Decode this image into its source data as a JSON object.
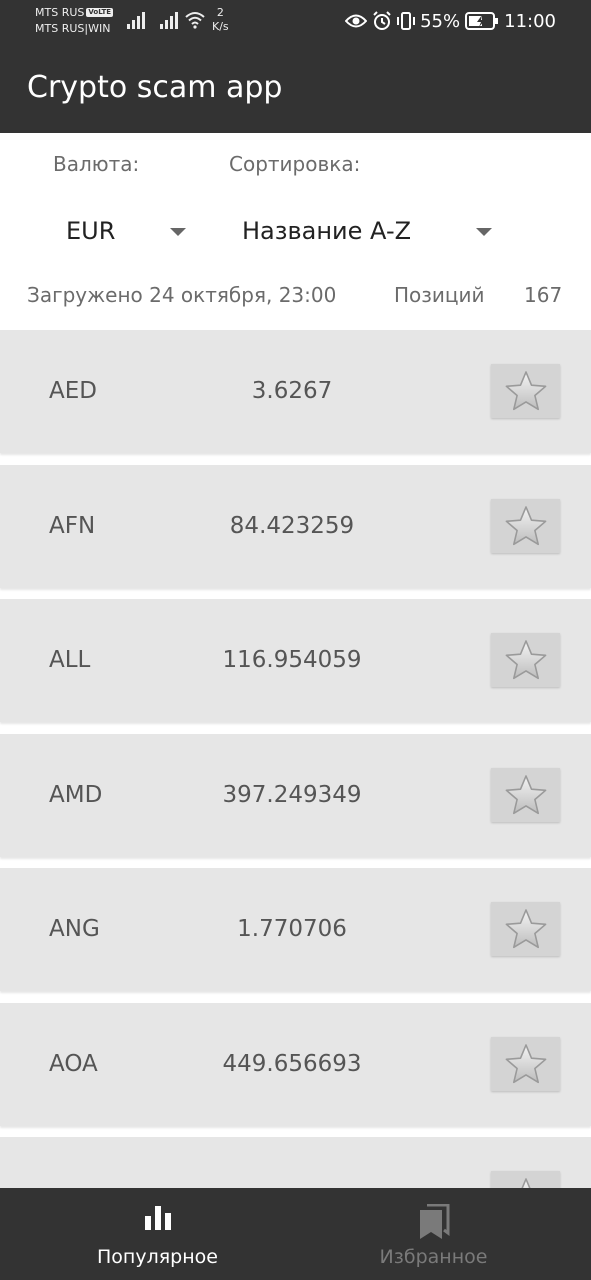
{
  "status_bar": {
    "carrier1": "MTS RUS",
    "volte": "VoLTE",
    "carrier2": "MTS RUS|WIN",
    "speed_value": "2",
    "speed_unit": "K/s",
    "battery": "55%",
    "time": "11:00"
  },
  "app_bar": {
    "title": "Crypto scam app"
  },
  "controls": {
    "currency_label": "Валюта:",
    "currency_value": "EUR",
    "sort_label": "Сортировка:",
    "sort_value": "Название A-Z"
  },
  "meta": {
    "loaded": "Загружено 24 октября, 23:00",
    "positions_label": "Позиций",
    "positions_count": "167"
  },
  "rates": [
    {
      "code": "AED",
      "value": "3.6267"
    },
    {
      "code": "AFN",
      "value": "84.423259"
    },
    {
      "code": "ALL",
      "value": "116.954059"
    },
    {
      "code": "AMD",
      "value": "397.249349"
    },
    {
      "code": "ANG",
      "value": "1.770706"
    },
    {
      "code": "AOA",
      "value": "449.656693"
    },
    {
      "code": "",
      "value": ""
    }
  ],
  "bottom_nav": {
    "popular": "Популярное",
    "favorites": "Избранное"
  },
  "colors": {
    "bar_background": "#333333",
    "row_background": "#e6e6e6",
    "favorite_button": "#d4d4d4",
    "nav_active": "#ffffff",
    "nav_inactive": "#7a7a7a"
  },
  "icons": {
    "favorite": "star-icon",
    "popular": "bar-chart-icon",
    "favorites": "bookmark-icon"
  }
}
